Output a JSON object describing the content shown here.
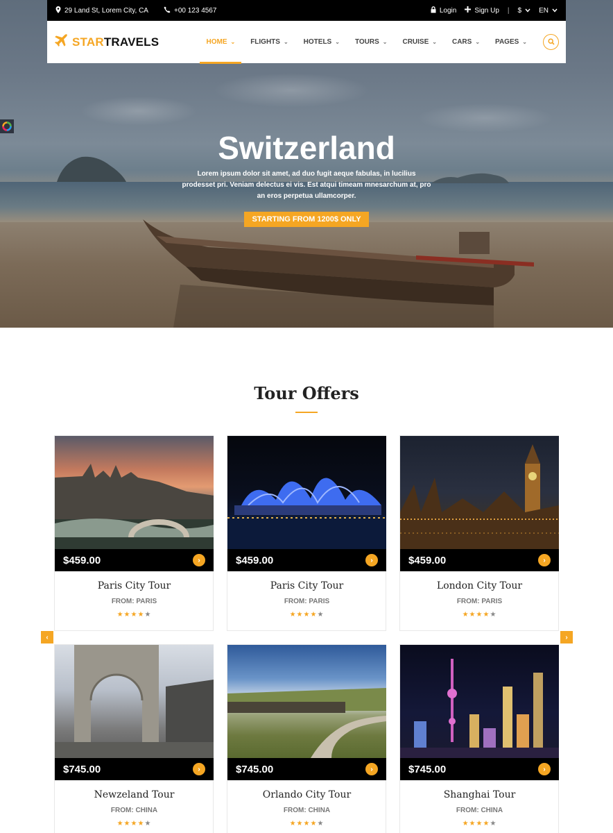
{
  "topbar": {
    "address": "29 Land St, Lorem City, CA",
    "phone": "+00 123 4567",
    "login": "Login",
    "signup": "Sign Up",
    "currency": "$",
    "language": "EN"
  },
  "brand": {
    "part1": "STAR",
    "part2": "TRAVELS"
  },
  "nav": {
    "items": [
      {
        "label": "HOME"
      },
      {
        "label": "FLIGHTS"
      },
      {
        "label": "HOTELS"
      },
      {
        "label": "TOURS"
      },
      {
        "label": "CRUISE"
      },
      {
        "label": "CARS"
      },
      {
        "label": "PAGES"
      }
    ]
  },
  "hero": {
    "title": "Switzerland",
    "text": "Lorem ipsum dolor sit amet, ad duo fugit aeque fabulas, in lucilius prodesset pri. Veniam delectus ei vis. Est atqui timeam mnesarchum at, pro an eros perpetua ullamcorper.",
    "cta": "STARTING FROM 1200$ ONLY"
  },
  "offers": {
    "title": "Tour Offers",
    "cards": [
      {
        "price": "$459.00",
        "name": "Paris City Tour",
        "from": "FROM: PARIS",
        "rating": 4
      },
      {
        "price": "$459.00",
        "name": "Paris City Tour",
        "from": "FROM: PARIS",
        "rating": 4
      },
      {
        "price": "$459.00",
        "name": "London City Tour",
        "from": "FROM: PARIS",
        "rating": 4
      },
      {
        "price": "$745.00",
        "name": "Newzeland Tour",
        "from": "FROM: CHINA",
        "rating": 4
      },
      {
        "price": "$745.00",
        "name": "Orlando City Tour",
        "from": "FROM: CHINA",
        "rating": 4
      },
      {
        "price": "$745.00",
        "name": "Shanghai Tour",
        "from": "FROM: CHINA",
        "rating": 4
      }
    ]
  },
  "colors": {
    "accent": "#f5a623",
    "dark": "#000000"
  },
  "icons": {
    "address": "map-marker-icon",
    "phone": "phone-icon",
    "login": "lock-icon",
    "signup": "plus-icon",
    "logo": "plane-icon",
    "search": "search-icon",
    "prev": "chevron-left-icon",
    "next": "chevron-right-icon"
  }
}
